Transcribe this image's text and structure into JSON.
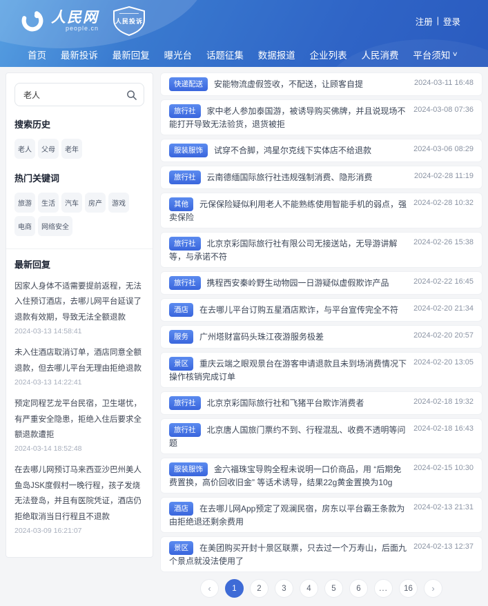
{
  "header": {
    "logo": {
      "brand": "人民网",
      "domain": "people.cn",
      "badge": "人民投诉"
    },
    "auth": {
      "register": "注册",
      "divider": "|",
      "login": "登录"
    },
    "nav": [
      {
        "label": "首页"
      },
      {
        "label": "最新投诉"
      },
      {
        "label": "最新回复"
      },
      {
        "label": "曝光台"
      },
      {
        "label": "话题征集"
      },
      {
        "label": "数据报道"
      },
      {
        "label": "企业列表"
      },
      {
        "label": "人民消费"
      },
      {
        "label": "平台须知",
        "dropdown": true
      }
    ]
  },
  "sidebar": {
    "search": {
      "value": "老人"
    },
    "history": {
      "title": "搜索历史",
      "tags": [
        "老人",
        "父母",
        "老年"
      ]
    },
    "hot": {
      "title": "热门关键词",
      "tags": [
        "旅游",
        "生活",
        "汽车",
        "房产",
        "游戏",
        "电商",
        "网络安全"
      ]
    },
    "replies": {
      "title": "最新回复",
      "items": [
        {
          "text": "因家人身体不适需要提前返程，无法入住预订酒店，去哪儿网平台延误了退款有效期，导致无法全额退款",
          "time": "2024-03-13 14:58:41"
        },
        {
          "text": "未入住酒店取消订单，酒店同意全额退款，但去哪儿平台无理由拒绝退款",
          "time": "2024-03-13 14:22:41"
        },
        {
          "text": "预定同程艺龙平台民宿，卫生堪忧，有严重安全隐患，拒绝入住后要求全额退款遭拒",
          "time": "2024-03-14 18:52:48"
        },
        {
          "text": "在去哪儿网预订马来西亚沙巴州美人鱼岛JSK度假村一晚行程，孩子发烧无法登岛，并且有医院凭证，酒店仍拒绝取消当日行程且不退款",
          "time": "2024-03-09 16:21:07"
        }
      ]
    }
  },
  "main": {
    "complaints": [
      {
        "category": "快递配送",
        "title": "安能物流虚假签收，不配送，让顾客自提",
        "date": "2024-03-11 16:48"
      },
      {
        "category": "旅行社",
        "title": "家中老人参加泰国游，被诱导购买佛牌，并且说现场不能打开导致无法验货，退货被拒",
        "date": "2024-03-08 07:36"
      },
      {
        "category": "服装服饰",
        "title": "试穿不合脚，鸿星尔克线下实体店不给退款",
        "date": "2024-03-06 08:29"
      },
      {
        "category": "旅行社",
        "title": "云南德缅国际旅行社违规强制消费、隐形消费",
        "date": "2024-02-28 11:19"
      },
      {
        "category": "其他",
        "title": "元保保险疑似利用老人不能熟练使用智能手机的弱点，强卖保险",
        "date": "2024-02-28 10:32"
      },
      {
        "category": "旅行社",
        "title": "北京京彩国际旅行社有限公司无接送站，无导游讲解等，与承诺不符",
        "date": "2024-02-26 15:38"
      },
      {
        "category": "旅行社",
        "title": "携程西安秦岭野生动物园一日游疑似虚假欺诈产品",
        "date": "2024-02-22 16:45"
      },
      {
        "category": "酒店",
        "title": "在去哪儿平台订购五星酒店欺诈，与平台宣传完全不符",
        "date": "2024-02-20 21:34"
      },
      {
        "category": "服务",
        "title": "广州塔财富码头珠江夜游服务极差",
        "date": "2024-02-20 20:57"
      },
      {
        "category": "景区",
        "title": "重庆云端之眼观景台在游客申请退款且未到场消费情况下操作核销完成订单",
        "date": "2024-02-20 13:05"
      },
      {
        "category": "旅行社",
        "title": "北京京彩国际旅行社和飞猪平台欺诈消费者",
        "date": "2024-02-18 19:32"
      },
      {
        "category": "旅行社",
        "title": "北京唐人国旅门票约不到、行程混乱、收费不透明等问题",
        "date": "2024-02-18 16:43"
      },
      {
        "category": "服装服饰",
        "title": "金六福珠宝导购全程未说明一口价商品，用 “后期免费置换，高价回收旧金” 等话术诱导，结果22g黄金置换为10g",
        "date": "2024-02-15 10:30"
      },
      {
        "category": "酒店",
        "title": "在去哪儿网App预定了观澜民宿，房东以平台霸王条款为由拒绝退还剩余费用",
        "date": "2024-02-13 21:31"
      },
      {
        "category": "景区",
        "title": "在美团购买开封十景区联票，只去过一个万寿山，后面九个景点就没法使用了",
        "date": "2024-02-13 12:37"
      }
    ],
    "pagination": {
      "prev": "‹",
      "pages": [
        "1",
        "2",
        "3",
        "4",
        "5",
        "6",
        "...",
        "16"
      ],
      "active": "1",
      "next": "›"
    }
  },
  "colors": {
    "header_gradient_start": "#57a0e2",
    "header_gradient_end": "#2a5bbf",
    "badge_blue": "#3a66dd",
    "active_page": "#3e6bd6",
    "page_background": "#f4f5f7"
  }
}
